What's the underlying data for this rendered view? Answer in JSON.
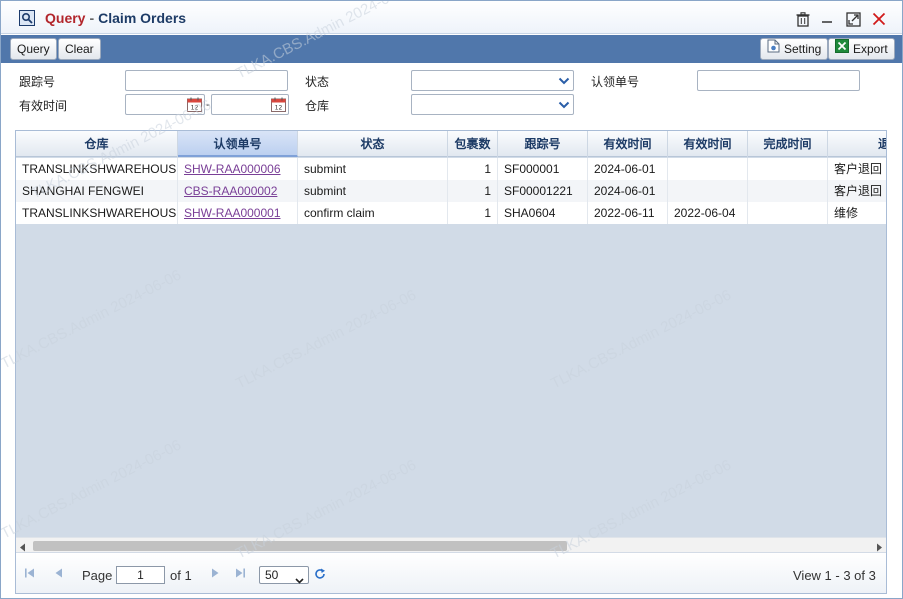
{
  "window": {
    "title_prefix": "Query",
    "title_separator": "-",
    "title": "Claim Orders"
  },
  "toolbar": {
    "query_label": "Query",
    "clear_label": "Clear",
    "setting_label": "Setting",
    "export_label": "Export"
  },
  "form": {
    "tracking_no_label": "跟踪号",
    "tracking_no_value": "",
    "status_label": "状态",
    "status_value": "",
    "claim_no_label": "认领单号",
    "claim_no_value": "",
    "valid_time_label": "有效时间",
    "valid_time_from": "",
    "valid_time_sep": "-",
    "valid_time_to": "",
    "warehouse_label": "仓库",
    "warehouse_value": ""
  },
  "grid": {
    "columns": [
      "仓库",
      "认领单号",
      "状态",
      "包裹数",
      "跟踪号",
      "有效时间",
      "有效时间",
      "完成时间",
      "退"
    ],
    "rows": [
      {
        "warehouse": "TRANSLINKSHWAREHOUSE",
        "claim_no": "SHW-RAA000006",
        "status": "submint",
        "packages": "1",
        "tracking": "SF000001",
        "valid_from": "2024-06-01",
        "valid_to": "",
        "completed": "",
        "type": "客户退回"
      },
      {
        "warehouse": "SHANGHAI FENGWEI",
        "claim_no": "CBS-RAA000002",
        "status": "submint",
        "packages": "1",
        "tracking": "SF00001221",
        "valid_from": "2024-06-01",
        "valid_to": "",
        "completed": "",
        "type": "客户退回"
      },
      {
        "warehouse": "TRANSLINKSHWAREHOUSE",
        "claim_no": "SHW-RAA000001",
        "status": "confirm claim",
        "packages": "1",
        "tracking": "SHA0604",
        "valid_from": "2022-06-11",
        "valid_to": "2022-06-04",
        "completed": "",
        "type": "维修"
      }
    ]
  },
  "pager": {
    "page_label": "Page",
    "page_value": "1",
    "of_label": "of 1",
    "page_size": "50",
    "view_text": "View 1 - 3 of 3"
  },
  "watermark": "TLKA.CBS.Admin 2024-06-06",
  "icons": {
    "app": "search-window-icon",
    "delete": "trash-icon",
    "minimize": "minimize-icon",
    "maximize": "maximize-icon",
    "close": "close-icon",
    "setting": "document-setting-icon",
    "export": "excel-icon",
    "calendar": "calendar-icon",
    "first": "first-page-icon",
    "prev": "prev-page-icon",
    "next": "next-page-icon",
    "last": "last-page-icon",
    "refresh": "refresh-icon"
  },
  "colors": {
    "toolbar": "#5077ab",
    "title_accent": "#b2262c",
    "title_main": "#1d3b66",
    "link": "#7a3f97"
  }
}
